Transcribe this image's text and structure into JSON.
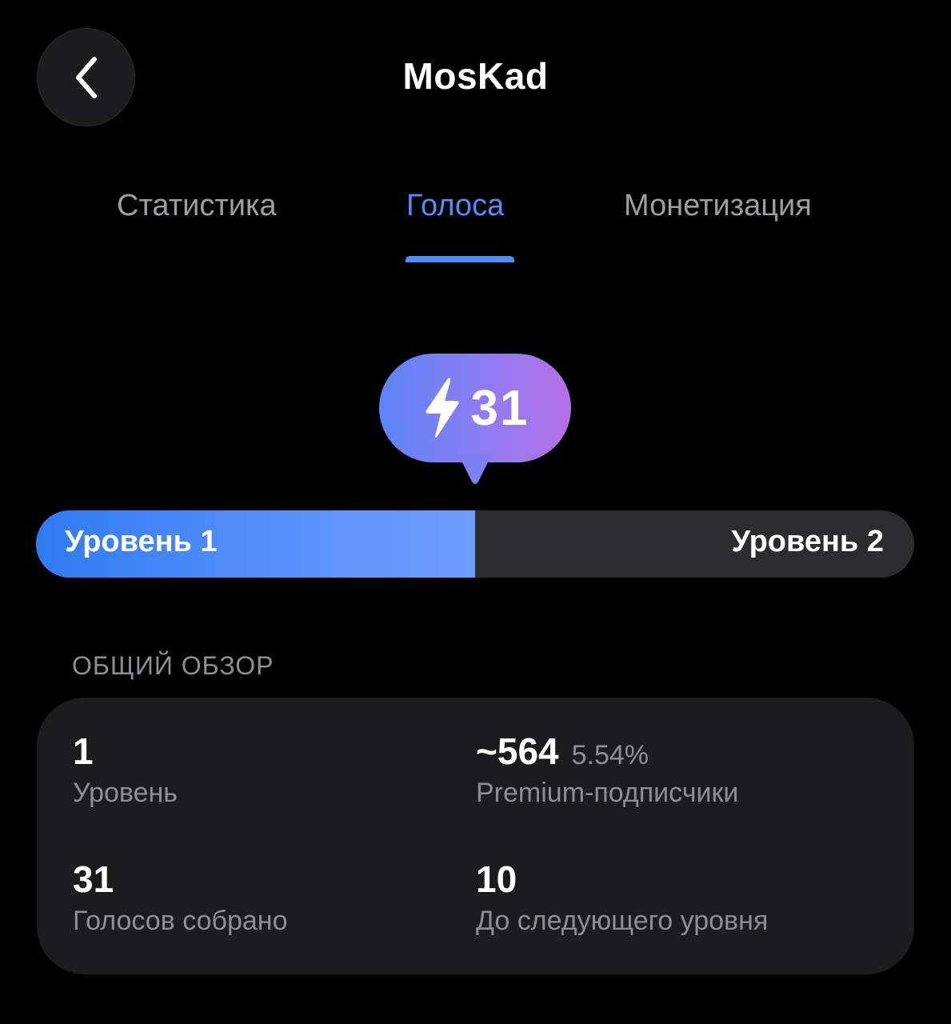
{
  "header": {
    "title": "MosKad",
    "back_icon": "chevron-left-icon"
  },
  "tabs": [
    {
      "label": "Статистика",
      "active": false
    },
    {
      "label": "Голоса",
      "active": true
    },
    {
      "label": "Монетизация",
      "active": false
    }
  ],
  "boost": {
    "icon": "lightning-icon",
    "value": "31",
    "gradient": [
      "#5b85f7",
      "#b46fe6"
    ]
  },
  "progress": {
    "current_level_label": "Уровень 1",
    "next_level_label": "Уровень 2",
    "fraction": 0.5,
    "fill_color": "#4f8ef7"
  },
  "overview": {
    "section_title": "ОБЩИЙ ОБЗОР",
    "stats": [
      {
        "value": "1",
        "extra": "",
        "label": "Уровень"
      },
      {
        "value": "~564",
        "extra": "5.54%",
        "label": "Premium-подписчики"
      },
      {
        "value": "31",
        "extra": "",
        "label": "Голосов собрано"
      },
      {
        "value": "10",
        "extra": "",
        "label": "До следующего уровня"
      }
    ]
  },
  "colors": {
    "background": "#000000",
    "card": "#1c1c1e",
    "accent": "#4f8ef7",
    "muted_text": "#8e8e93"
  }
}
